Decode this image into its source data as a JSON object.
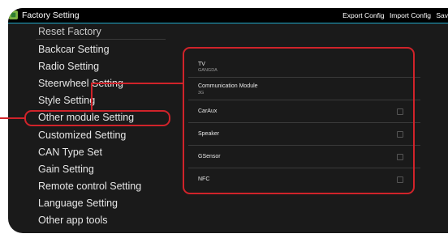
{
  "titlebar": {
    "title": "Factory Setting",
    "actions": [
      "Export Config",
      "Import Config",
      "Sav"
    ]
  },
  "left_menu": {
    "items": [
      {
        "label": "Reset Factory",
        "partial": true
      },
      {
        "label": "Backcar Setting"
      },
      {
        "label": "Radio Setting"
      },
      {
        "label": "Steerwheel Setting"
      },
      {
        "label": "Style Setting"
      },
      {
        "label": "Other module Setting",
        "selected": true
      },
      {
        "label": "Customized Setting"
      },
      {
        "label": "CAN Type Set"
      },
      {
        "label": "Gain Setting"
      },
      {
        "label": "Remote control Setting"
      },
      {
        "label": "Language Setting"
      },
      {
        "label": "Other app tools"
      }
    ]
  },
  "module_settings": [
    {
      "title": "TV",
      "subtitle": "GANGDA",
      "has_checkbox": false
    },
    {
      "title": "Communication Module",
      "subtitle": "3G",
      "has_checkbox": false
    },
    {
      "title": "CarAux",
      "subtitle": "",
      "has_checkbox": true,
      "checked": false
    },
    {
      "title": "Speaker",
      "subtitle": "",
      "has_checkbox": true,
      "checked": false
    },
    {
      "title": "GSensor",
      "subtitle": "",
      "has_checkbox": true,
      "checked": false
    },
    {
      "title": "NFC",
      "subtitle": "",
      "has_checkbox": true,
      "checked": false
    }
  ],
  "colors": {
    "accent": "#1fa9c9",
    "annotation": "#d0232a",
    "background": "#1a1a1a",
    "text": "#e6e6e6"
  },
  "icons": {
    "app": "android-app-icon"
  }
}
